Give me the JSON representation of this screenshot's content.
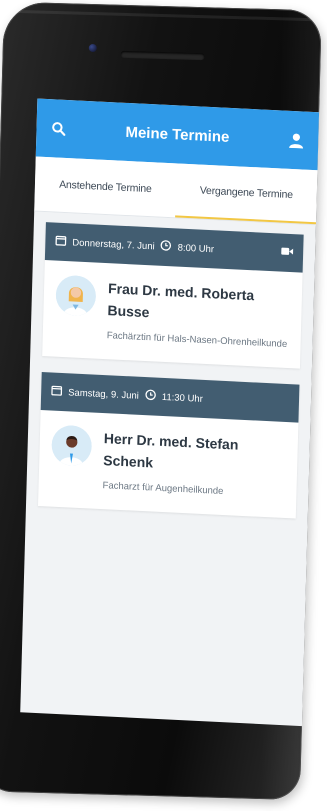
{
  "appbar": {
    "title": "Meine Termine",
    "search_icon": "search-icon",
    "profile_icon": "user-icon",
    "color": "#2f9ae8"
  },
  "tabs": [
    {
      "label": "Anstehende Termine",
      "active": false
    },
    {
      "label": "Vergangene Termine",
      "active": true
    }
  ],
  "appointments": [
    {
      "date": "Donnerstag, 7. Juni",
      "time": "8:00 Uhr",
      "video": true,
      "doctor": "Frau Dr. med. Roberta Busse",
      "specialty": "Fachärztin für Hals-Nasen-Ohrenheilkunde"
    },
    {
      "date": "Samstag, 9. Juni",
      "time": "11:30 Uhr",
      "video": false,
      "doctor": "Herr Dr. med. Stefan Schenk",
      "specialty": "Facharzt für Augenheilkunde"
    }
  ],
  "colors": {
    "card_header": "#425d71",
    "tab_indicator": "#f2c744",
    "background": "#f1f3f5"
  }
}
